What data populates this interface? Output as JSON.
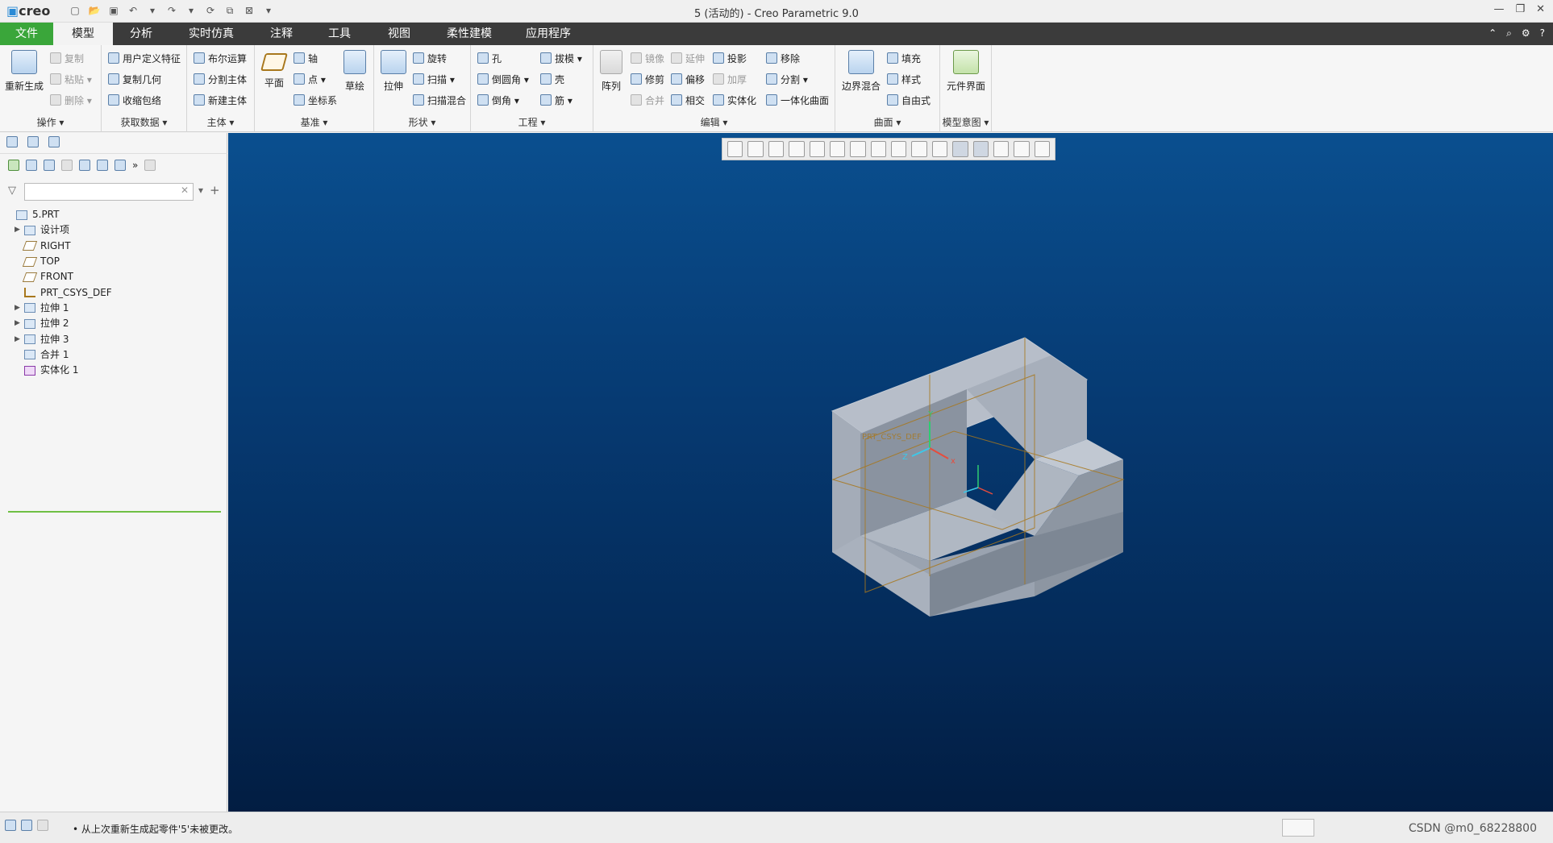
{
  "app": {
    "logo": "creo",
    "window_title": "5 (活动的) - Creo Parametric 9.0"
  },
  "menu_tabs": [
    "文件",
    "模型",
    "分析",
    "实时仿真",
    "注释",
    "工具",
    "视图",
    "柔性建模",
    "应用程序"
  ],
  "ribbon": {
    "groups": {
      "operations": {
        "label": "操作 ▾",
        "regenerate": "重新生成",
        "copy": "复制",
        "paste": "粘贴 ▾",
        "delete": "删除 ▾"
      },
      "get_data": {
        "label": "获取数据 ▾",
        "user_feature": "用户定义特征",
        "copy_geom": "复制几何",
        "shrinkwrap": "收缩包络"
      },
      "body": {
        "label": "主体 ▾",
        "boolean": "布尔运算",
        "split_body": "分割主体",
        "new_body": "新建主体"
      },
      "datum": {
        "label": "基准 ▾",
        "plane": "平面",
        "axis": "轴",
        "point": "点 ▾",
        "csys": "坐标系",
        "sketch": "草绘"
      },
      "shapes": {
        "label": "形状 ▾",
        "extrude": "拉伸",
        "revolve": "旋转",
        "sweep": "扫描 ▾",
        "swept_blend": "扫描混合"
      },
      "engineering": {
        "label": "工程 ▾",
        "hole": "孔",
        "round": "倒圆角 ▾",
        "chamfer": "倒角 ▾",
        "draft": "拔模 ▾",
        "shell": "壳",
        "rib": "筋 ▾"
      },
      "editing": {
        "label": "编辑 ▾",
        "pattern": "阵列",
        "mirror": "镜像",
        "extend": "延伸",
        "project": "投影",
        "trim": "修剪",
        "offset": "偏移",
        "thicken": "加厚",
        "merge": "合并",
        "intersect": "相交",
        "solidify": "实体化",
        "remove": "移除",
        "split": "分割 ▾",
        "unify": "一体化曲面"
      },
      "surfaces": {
        "label": "曲面 ▾",
        "boundary_blend": "边界混合",
        "fill": "填充",
        "style": "样式",
        "freestyle": "自由式"
      },
      "model_intent": {
        "label": "模型意图 ▾",
        "component_interface": "元件界面"
      }
    }
  },
  "tree": {
    "search_placeholder": "",
    "nodes": [
      {
        "label": "5.PRT",
        "expand": ""
      },
      {
        "label": "设计项",
        "expand": "▶"
      },
      {
        "label": "RIGHT",
        "expand": ""
      },
      {
        "label": "TOP",
        "expand": ""
      },
      {
        "label": "FRONT",
        "expand": ""
      },
      {
        "label": "PRT_CSYS_DEF",
        "expand": ""
      },
      {
        "label": "拉伸 1",
        "expand": "▶"
      },
      {
        "label": "拉伸 2",
        "expand": "▶"
      },
      {
        "label": "拉伸 3",
        "expand": "▶"
      },
      {
        "label": "合并 1",
        "expand": ""
      },
      {
        "label": "实体化 1",
        "expand": ""
      }
    ]
  },
  "graphics": {
    "csys_labels": {
      "x": "x",
      "y": "Y",
      "z": "Z"
    },
    "csys_name": "PRT_CSYS_DEF"
  },
  "status": {
    "message": "• 从上次重新生成起零件'5'未被更改。",
    "watermark": "CSDN @m0_68228800"
  },
  "colors": {
    "file_tab": "#3aa63a",
    "tab_bar": "#3b3b3b",
    "bg_top": "#0a4f8f",
    "bg_bottom": "#021d42",
    "model_light": "#b7bec9",
    "model_mid": "#9aa3b0",
    "model_dark": "#7d8794",
    "datum": "#a8771c"
  }
}
